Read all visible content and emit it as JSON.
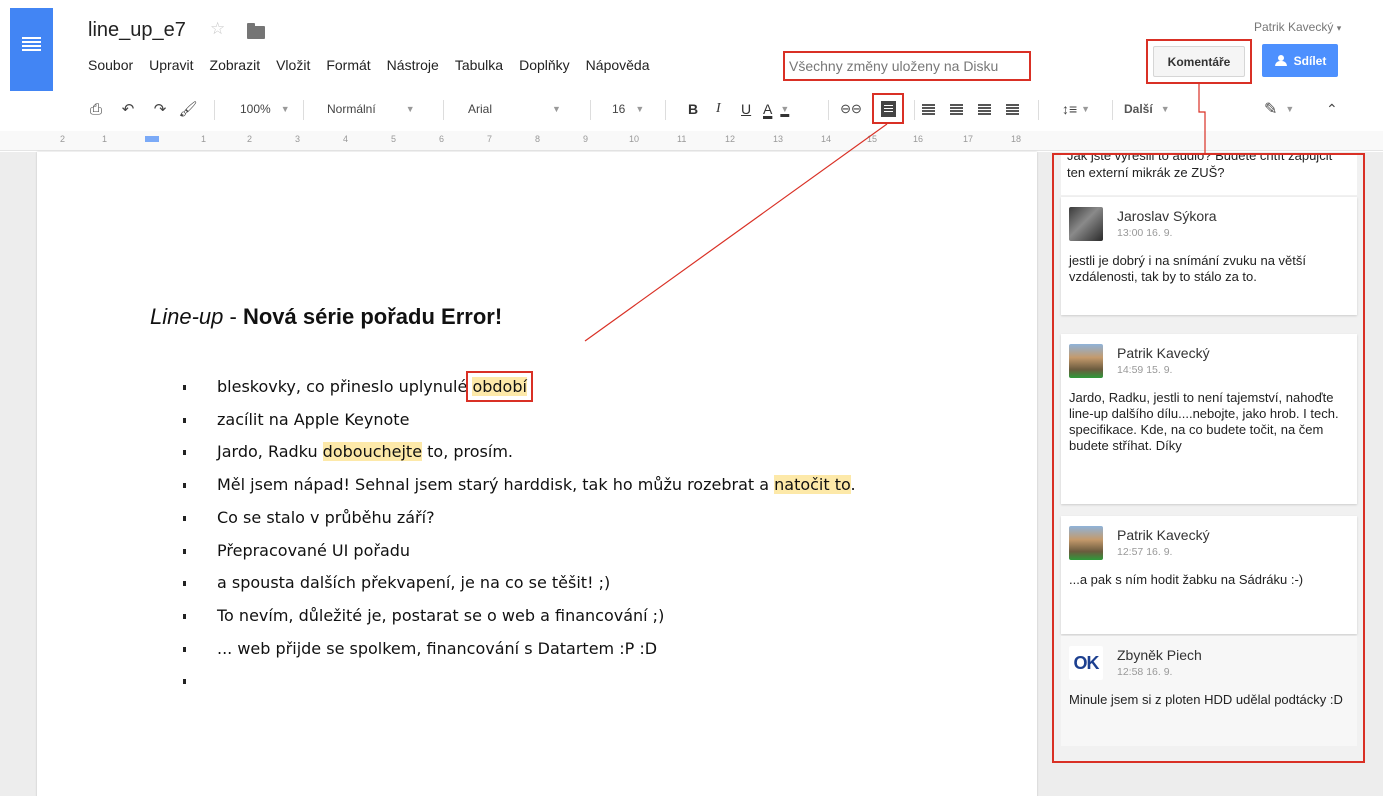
{
  "document": {
    "title": "line_up_e7",
    "save_status": "Všechny změny uloženy na Disku"
  },
  "menu": [
    "Soubor",
    "Upravit",
    "Zobrazit",
    "Vložit",
    "Formát",
    "Nástroje",
    "Tabulka",
    "Doplňky",
    "Nápověda"
  ],
  "user": {
    "name": "Patrik Kavecký"
  },
  "buttons": {
    "comments": "Komentáře",
    "share": "Sdílet"
  },
  "toolbar": {
    "zoom": "100%",
    "style": "Normální",
    "font": "Arial",
    "font_size": "16",
    "bold": "B",
    "italic": "I",
    "underline": "U",
    "text_color": "A",
    "more": "Další"
  },
  "ruler": [
    "2",
    "1",
    "1",
    "2",
    "3",
    "4",
    "5",
    "6",
    "7",
    "8",
    "9",
    "10",
    "11",
    "12",
    "13",
    "14",
    "15",
    "16",
    "17",
    "18"
  ],
  "heading": {
    "italic": "Line-up",
    "separator": " - ",
    "bold": "Nová série pořadu Error!"
  },
  "bullets": [
    {
      "before": "bleskovky, co přineslo uplynulé ",
      "highlight": "období",
      "after": ""
    },
    {
      "before": "zacílit na Apple Keynote",
      "highlight": "",
      "after": ""
    },
    {
      "before": "Jardo, Radku ",
      "highlight": "dobouchejte",
      "after": " to, prosím."
    },
    {
      "before": "Měl jsem nápad! Sehnal jsem starý harddisk, tak ho můžu rozebrat a ",
      "highlight": "natočit to",
      "after": "."
    },
    {
      "before": "Co se stalo v průběhu září?",
      "highlight": "",
      "after": ""
    },
    {
      "before": "Přepracované UI pořadu",
      "highlight": "",
      "after": ""
    },
    {
      "before": "a spousta dalších překvapení, je na co se těšit! ;)",
      "highlight": "",
      "after": ""
    },
    {
      "before": "To nevím, důležité je, postarat se o web a financování ;)",
      "highlight": "",
      "after": ""
    },
    {
      "before": "... web přijde se spolkem, financování s Datartem :P :D",
      "highlight": "",
      "after": ""
    },
    {
      "before": "",
      "highlight": "",
      "after": ""
    }
  ],
  "comments_panel": {
    "top_text": "Jak jste vyřešili to audio? Budete chtít zapůjčit ten externí mikrák ze ZUŠ?",
    "comments": [
      {
        "author": "Jaroslav Sýkora",
        "time": "13:00 16. 9.",
        "text": "jestli je dobrý i na snímání zvuku na větší vzdálenosti, tak by to stálo za to."
      },
      {
        "author": "Patrik Kavecký",
        "time": "14:59 15. 9.",
        "text": "Jardo, Radku, jestli to není tajemství, nahoďte line-up dalšího dílu....nebojte, jako hrob. I tech. specifikace. Kde, na co budete točit, na čem budete stříhat. Díky"
      },
      {
        "author": "Patrik Kavecký",
        "time": "12:57 16. 9.",
        "text": "...a pak s ním hodit žabku na Sádráku :-)"
      },
      {
        "author": "Zbyněk Piech",
        "time": "12:58 16. 9.",
        "text": "Minule jsem si z ploten HDD udělal podtácky :D",
        "avatar_text": "OK"
      }
    ]
  },
  "colors": {
    "accent": "#4285f4",
    "annotation": "#d93025",
    "highlight": "#fde9a9",
    "share": "#4d90fe"
  }
}
